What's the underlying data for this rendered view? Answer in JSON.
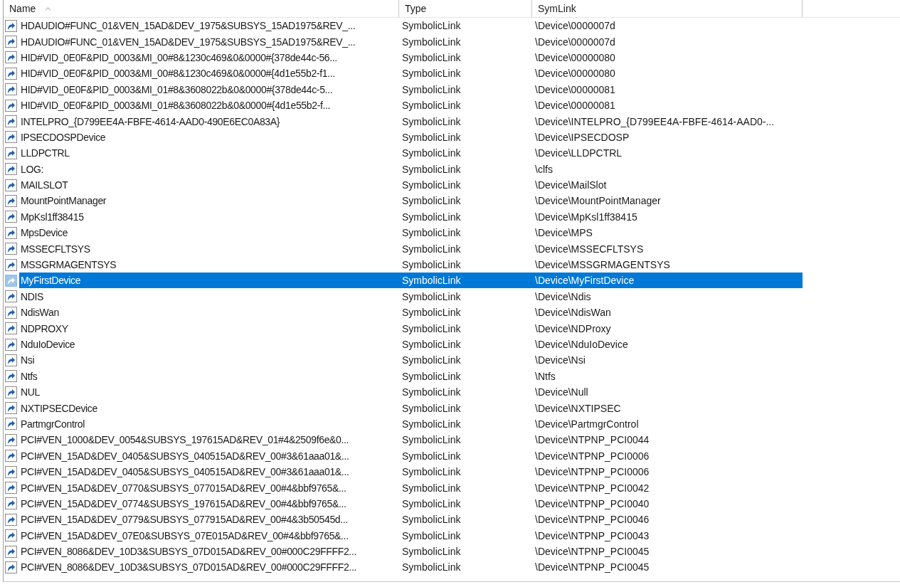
{
  "table": {
    "columns": [
      {
        "label": "Name",
        "sorted": true
      },
      {
        "label": "Type",
        "sorted": false
      },
      {
        "label": "SymLink",
        "sorted": false
      }
    ],
    "rows": [
      {
        "name": "HDAUDIO#FUNC_01&VEN_15AD&DEV_1975&SUBSYS_15AD1975&REV_...",
        "type": "SymbolicLink",
        "symlink": "\\Device\\0000007d",
        "selected": false
      },
      {
        "name": "HDAUDIO#FUNC_01&VEN_15AD&DEV_1975&SUBSYS_15AD1975&REV_...",
        "type": "SymbolicLink",
        "symlink": "\\Device\\0000007d",
        "selected": false
      },
      {
        "name": "HID#VID_0E0F&PID_0003&MI_00#8&1230c469&0&0000#{378de44c-56...",
        "type": "SymbolicLink",
        "symlink": "\\Device\\00000080",
        "selected": false
      },
      {
        "name": "HID#VID_0E0F&PID_0003&MI_00#8&1230c469&0&0000#{4d1e55b2-f1...",
        "type": "SymbolicLink",
        "symlink": "\\Device\\00000080",
        "selected": false
      },
      {
        "name": "HID#VID_0E0F&PID_0003&MI_01#8&3608022b&0&0000#{378de44c-5...",
        "type": "SymbolicLink",
        "symlink": "\\Device\\00000081",
        "selected": false
      },
      {
        "name": "HID#VID_0E0F&PID_0003&MI_01#8&3608022b&0&0000#{4d1e55b2-f...",
        "type": "SymbolicLink",
        "symlink": "\\Device\\00000081",
        "selected": false
      },
      {
        "name": "INTELPRO_{D799EE4A-FBFE-4614-AAD0-490E6EC0A83A}",
        "type": "SymbolicLink",
        "symlink": "\\Device\\INTELPRO_{D799EE4A-FBFE-4614-AAD0-...",
        "selected": false
      },
      {
        "name": "IPSECDOSPDevice",
        "type": "SymbolicLink",
        "symlink": "\\Device\\IPSECDOSP",
        "selected": false
      },
      {
        "name": "LLDPCTRL",
        "type": "SymbolicLink",
        "symlink": "\\Device\\LLDPCTRL",
        "selected": false
      },
      {
        "name": "LOG:",
        "type": "SymbolicLink",
        "symlink": "\\clfs",
        "selected": false
      },
      {
        "name": "MAILSLOT",
        "type": "SymbolicLink",
        "symlink": "\\Device\\MailSlot",
        "selected": false
      },
      {
        "name": "MountPointManager",
        "type": "SymbolicLink",
        "symlink": "\\Device\\MountPointManager",
        "selected": false
      },
      {
        "name": "MpKsl1ff38415",
        "type": "SymbolicLink",
        "symlink": "\\Device\\MpKsl1ff38415",
        "selected": false
      },
      {
        "name": "MpsDevice",
        "type": "SymbolicLink",
        "symlink": "\\Device\\MPS",
        "selected": false
      },
      {
        "name": "MSSECFLTSYS",
        "type": "SymbolicLink",
        "symlink": "\\Device\\MSSECFLTSYS",
        "selected": false
      },
      {
        "name": "MSSGRMAGENTSYS",
        "type": "SymbolicLink",
        "symlink": "\\Device\\MSSGRMAGENTSYS",
        "selected": false
      },
      {
        "name": "MyFirstDevice",
        "type": "SymbolicLink",
        "symlink": "\\Device\\MyFirstDevice",
        "selected": true
      },
      {
        "name": "NDIS",
        "type": "SymbolicLink",
        "symlink": "\\Device\\Ndis",
        "selected": false
      },
      {
        "name": "NdisWan",
        "type": "SymbolicLink",
        "symlink": "\\Device\\NdisWan",
        "selected": false
      },
      {
        "name": "NDPROXY",
        "type": "SymbolicLink",
        "symlink": "\\Device\\NDProxy",
        "selected": false
      },
      {
        "name": "NduIoDevice",
        "type": "SymbolicLink",
        "symlink": "\\Device\\NduIoDevice",
        "selected": false
      },
      {
        "name": "Nsi",
        "type": "SymbolicLink",
        "symlink": "\\Device\\Nsi",
        "selected": false
      },
      {
        "name": "Ntfs",
        "type": "SymbolicLink",
        "symlink": "\\Ntfs",
        "selected": false
      },
      {
        "name": "NUL",
        "type": "SymbolicLink",
        "symlink": "\\Device\\Null",
        "selected": false
      },
      {
        "name": "NXTIPSECDevice",
        "type": "SymbolicLink",
        "symlink": "\\Device\\NXTIPSEC",
        "selected": false
      },
      {
        "name": "PartmgrControl",
        "type": "SymbolicLink",
        "symlink": "\\Device\\PartmgrControl",
        "selected": false
      },
      {
        "name": "PCI#VEN_1000&DEV_0054&SUBSYS_197615AD&REV_01#4&2509f6e&0...",
        "type": "SymbolicLink",
        "symlink": "\\Device\\NTPNP_PCI0044",
        "selected": false
      },
      {
        "name": "PCI#VEN_15AD&DEV_0405&SUBSYS_040515AD&REV_00#3&61aaa01&...",
        "type": "SymbolicLink",
        "symlink": "\\Device\\NTPNP_PCI0006",
        "selected": false
      },
      {
        "name": "PCI#VEN_15AD&DEV_0405&SUBSYS_040515AD&REV_00#3&61aaa01&...",
        "type": "SymbolicLink",
        "symlink": "\\Device\\NTPNP_PCI0006",
        "selected": false
      },
      {
        "name": "PCI#VEN_15AD&DEV_0770&SUBSYS_077015AD&REV_00#4&bbf9765&...",
        "type": "SymbolicLink",
        "symlink": "\\Device\\NTPNP_PCI0042",
        "selected": false
      },
      {
        "name": "PCI#VEN_15AD&DEV_0774&SUBSYS_197615AD&REV_00#4&bbf9765&...",
        "type": "SymbolicLink",
        "symlink": "\\Device\\NTPNP_PCI0040",
        "selected": false
      },
      {
        "name": "PCI#VEN_15AD&DEV_0779&SUBSYS_077915AD&REV_00#4&3b50545d...",
        "type": "SymbolicLink",
        "symlink": "\\Device\\NTPNP_PCI0046",
        "selected": false
      },
      {
        "name": "PCI#VEN_15AD&DEV_07E0&SUBSYS_07E015AD&REV_00#4&bbf9765&...",
        "type": "SymbolicLink",
        "symlink": "\\Device\\NTPNP_PCI0043",
        "selected": false
      },
      {
        "name": "PCI#VEN_8086&DEV_10D3&SUBSYS_07D015AD&REV_00#000C29FFFF2...",
        "type": "SymbolicLink",
        "symlink": "\\Device\\NTPNP_PCI0045",
        "selected": false
      },
      {
        "name": "PCI#VEN_8086&DEV_10D3&SUBSYS_07D015AD&REV_00#000C29FFFF2...",
        "type": "SymbolicLink",
        "symlink": "\\Device\\NTPNP_PCI0045",
        "selected": false
      }
    ]
  }
}
